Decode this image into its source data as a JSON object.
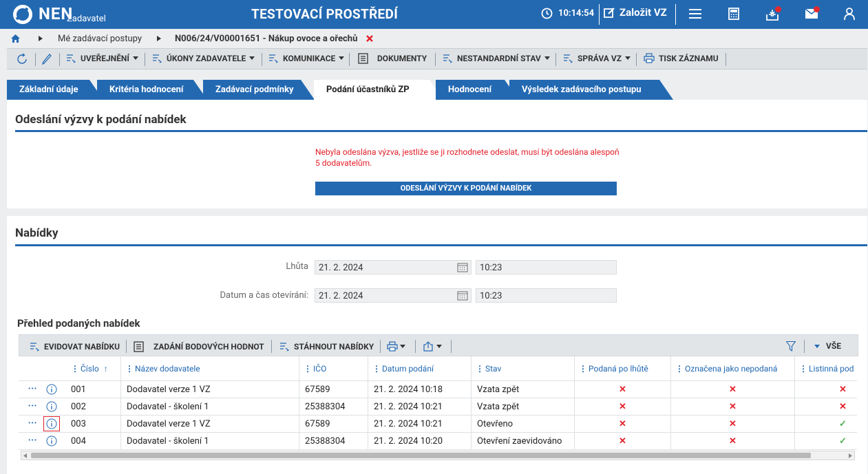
{
  "header": {
    "logo": "NEN",
    "logo_sub": "Zadavatel",
    "env_title": "TESTOVACÍ PROSTŘEDÍ",
    "time": "10:14:54",
    "create_label": "Založit VZ",
    "icons": [
      "clock-icon",
      "edit-icon",
      "menu-icon",
      "calculator-icon",
      "inbox-icon",
      "mail-icon",
      "user-icon"
    ],
    "accent_color": "#2369b2",
    "notification_color": "#e3292e"
  },
  "breadcrumb": {
    "home_icon": "home-icon",
    "item1": "Mé zadávací postupy",
    "item2": "N006/24/V00001651 - Nákup ovoce a ořechů",
    "close_icon": "close-icon"
  },
  "toolbar": {
    "refresh_icon": "refresh-icon",
    "edit_icon": "pencil-icon",
    "items": [
      "UVEŘEJNĚNÍ",
      "ÚKONY ZADAVATELE",
      "KOMUNIKACE",
      "DOKUMENTY",
      "NESTANDARDNÍ STAV",
      "SPRÁVA VZ",
      "TISK ZÁZNAMU"
    ]
  },
  "tabs": [
    "Základní údaje",
    "Kritéria hodnocení",
    "Zadávací podmínky",
    "Podání účastníků ZP",
    "Hodnocení",
    "Výsledek zadávacího postupu"
  ],
  "invite": {
    "title": "Odeslání výzvy k podání nabídek",
    "warning": "Nebyla odeslána výzva, jestliže se ji rozhodnete odeslat, musí být odeslána alespoň 5 dodavatelům.",
    "button": "ODESLÁNÍ VÝZVY K PODÁNÍ NABÍDEK"
  },
  "offers": {
    "title": "Nabídky",
    "deadline_label": "Lhůta",
    "deadline_date": "21. 2. 2024",
    "deadline_time": "10:23",
    "opening_label": "Datum a čas otevírání:",
    "opening_date": "21. 2. 2024",
    "opening_time": "10:23",
    "overview_title": "Přehled podaných nabídek"
  },
  "grid": {
    "toolbar": {
      "register": "EVIDOVAT NABÍDKU",
      "scores": "ZADÁNÍ BODOVÝCH HODNOT",
      "download": "STÁHNOUT NABÍDKY",
      "all": "VŠE"
    },
    "columns": [
      "Číslo",
      "Název dodavatele",
      "IČO",
      "Datum podání",
      "Stav",
      "Podaná po lhůtě",
      "Označena jako nepodaná",
      "Listinná pod"
    ],
    "rows": [
      {
        "num": "001",
        "name": "Dodavatel verze 1 VZ",
        "ico": "67589",
        "date": "21. 2. 2024 10:18",
        "state": "Vzata zpět",
        "late": "✕",
        "unsubmitted": "✕",
        "paper": "✕"
      },
      {
        "num": "002",
        "name": "Dodavatel - školení 1",
        "ico": "25388304",
        "date": "21. 2. 2024 10:21",
        "state": "Vzata zpět",
        "late": "✕",
        "unsubmitted": "✕",
        "paper": "✕"
      },
      {
        "num": "003",
        "name": "Dodavatel verze 1 VZ",
        "ico": "67589",
        "date": "21. 2. 2024 10:21",
        "state": "Otevřeno",
        "late": "✕",
        "unsubmitted": "✕",
        "paper": "✓"
      },
      {
        "num": "004",
        "name": "Dodavatel - školení 1",
        "ico": "25388304",
        "date": "21. 2. 2024 10:20",
        "state": "Otevření zaevidováno",
        "late": "✕",
        "unsubmitted": "✕",
        "paper": "✓"
      }
    ]
  }
}
